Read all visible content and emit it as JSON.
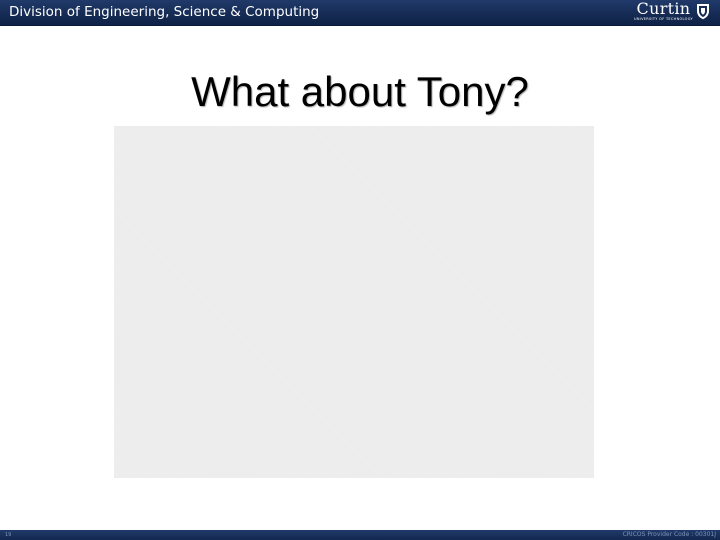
{
  "header": {
    "division_title": "Division of Engineering, Science & Computing",
    "logo": {
      "word": "Curtin",
      "subtitle": "UNIVERSITY OF TECHNOLOGY",
      "icon": "shield-crest-icon"
    }
  },
  "slide": {
    "title": "What about Tony?"
  },
  "footer": {
    "slide_number": "19",
    "cricos": "CRICOS Provider Code : 00301J"
  },
  "colors": {
    "header_bar": "#162c55",
    "footer_bar": "#1a3262",
    "image_placeholder": "#ececec"
  }
}
